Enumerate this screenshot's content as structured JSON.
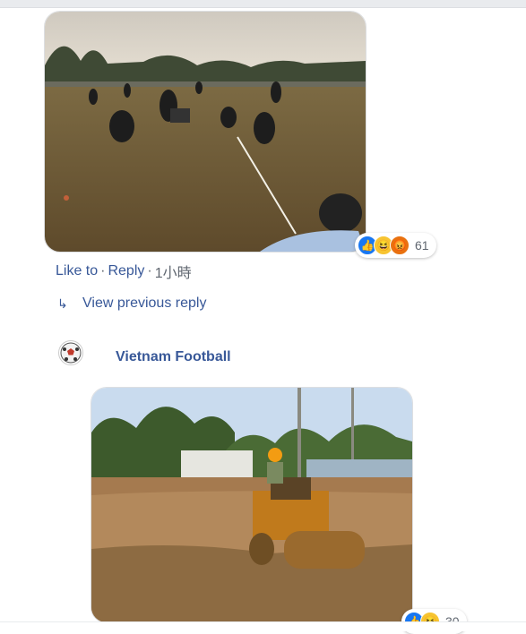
{
  "comment1": {
    "reactions": {
      "icons": [
        "like-icon",
        "haha-icon",
        "angry-icon"
      ],
      "count": "61"
    },
    "actions": {
      "like": "Like to",
      "reply": "Reply",
      "time": "1小時"
    }
  },
  "view_previous": {
    "label": "View previous reply"
  },
  "comment2": {
    "author": "Vietnam Football",
    "reactions": {
      "icons": [
        "like-icon",
        "haha-icon"
      ],
      "count": "30"
    }
  },
  "colors": {
    "link": "#385898",
    "meta": "#606770",
    "like": "#1877f2",
    "haha": "#f7c431",
    "angry": "#e9710f"
  }
}
